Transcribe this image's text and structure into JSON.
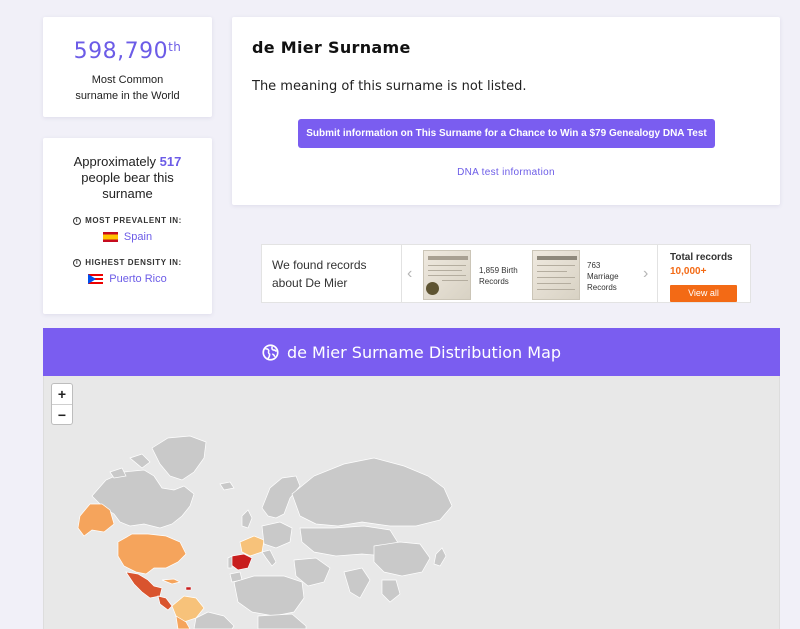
{
  "rank": {
    "number": "598,790",
    "suffix": "th",
    "line1": "Most Common",
    "line2": "surname in the World"
  },
  "bearers": {
    "prefix": "Approximately",
    "count": "517",
    "suffix": "people bear this surname",
    "most_prevalent_label": "MOST PREVALENT IN:",
    "most_prevalent_country": "Spain",
    "highest_density_label": "HIGHEST DENSITY IN:",
    "highest_density_country": "Puerto Rico"
  },
  "meaning": {
    "title": "de Mier Surname",
    "text": "The meaning of this surname is not listed.",
    "submit_button": "Submit information on This Surname for a Chance to Win a $79 Genealogy DNA Test",
    "dna_link": "DNA test information"
  },
  "records": {
    "found_text": "We found records about De Mier",
    "birth_label": "1,859 Birth Records",
    "marriage_label": "763 Marriage Records",
    "total_title": "Total records",
    "total_value": "10,000+",
    "view_button": "View all"
  },
  "map": {
    "title": "de Mier Surname Distribution Map",
    "zoom_in": "+",
    "zoom_out": "−",
    "colors": {
      "land": "#c9c9c9",
      "low": "#f7c27a",
      "mid": "#f5a45c",
      "high": "#d9542e",
      "top": "#c81e1e",
      "water": "#e8e8e8"
    }
  },
  "colors": {
    "accent": "#7a5df0",
    "accent_text": "#6c5ce7",
    "orange": "#f36a15",
    "page_bg": "#f1f0f8"
  },
  "icons": {
    "globe": "globe-icon",
    "info": "info-icon",
    "prev": "chevron-left-icon",
    "next": "chevron-right-icon"
  }
}
